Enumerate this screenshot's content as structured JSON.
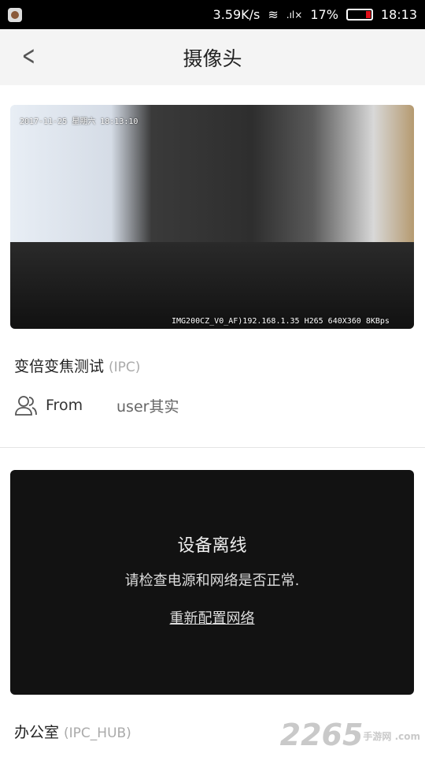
{
  "status_bar": {
    "net_speed": "3.59K/s",
    "battery": "17%",
    "time": "18:13",
    "battery_level": 0.17,
    "battery_color": "#e0101a"
  },
  "header": {
    "title": "摄像头",
    "back_icon": "chevron-left-icon"
  },
  "camera": {
    "osd_top": "2017-11-25 星期六 18:13:10",
    "osd_bottom": "IMG200CZ_V0_AF)192.168.1.35 H265 640X360 8KBps",
    "name": "变倍变焦测试",
    "type": "(IPC)",
    "from_label": "From",
    "from_value": "user其实"
  },
  "offline_card": {
    "title": "设备离线",
    "subtitle": "请检查电源和网络是否正常.",
    "link": "重新配置网络"
  },
  "device2": {
    "name": "办公室",
    "type": "(IPC_HUB)"
  },
  "watermark": {
    "text": "2265",
    "sub": "手游网 .com"
  }
}
